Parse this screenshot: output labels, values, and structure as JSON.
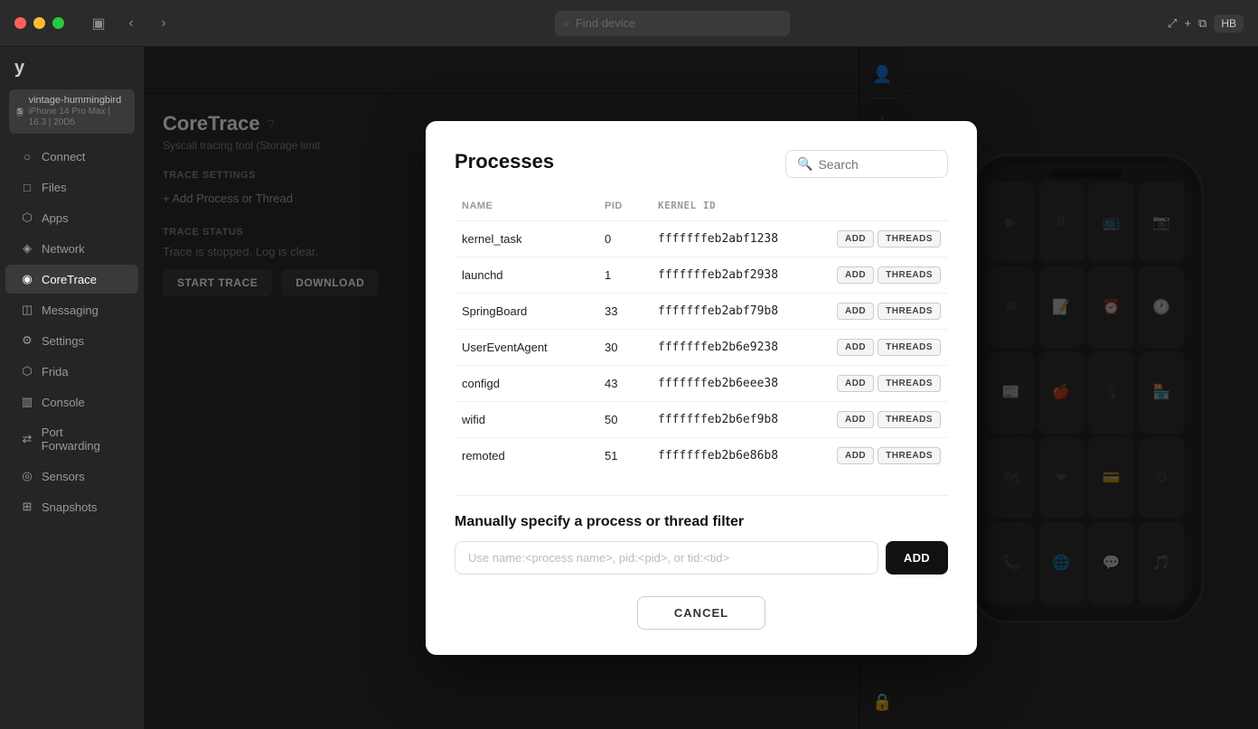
{
  "titleBar": {
    "findDevice": "Find device",
    "userBadge": "HB"
  },
  "sidebar": {
    "logo": "y",
    "device": {
      "name": "vintage-hummingbird",
      "details": "iPhone 14 Pro Max | 16.3 | 20D5"
    },
    "items": [
      {
        "id": "connect",
        "label": "Connect",
        "icon": "○"
      },
      {
        "id": "files",
        "label": "Files",
        "icon": "□"
      },
      {
        "id": "apps",
        "label": "Apps",
        "icon": "⬡"
      },
      {
        "id": "network",
        "label": "Network",
        "icon": "◈"
      },
      {
        "id": "coretrace",
        "label": "CoreTrace",
        "icon": "◉",
        "active": true
      },
      {
        "id": "messaging",
        "label": "Messaging",
        "icon": "◫"
      },
      {
        "id": "settings",
        "label": "Settings",
        "icon": "⚙"
      },
      {
        "id": "frida",
        "label": "Frida",
        "icon": "⬡"
      },
      {
        "id": "console",
        "label": "Console",
        "icon": "▥"
      },
      {
        "id": "portforwarding",
        "label": "Port Forwarding",
        "icon": "⇄"
      },
      {
        "id": "sensors",
        "label": "Sensors",
        "icon": "◎"
      },
      {
        "id": "snapshots",
        "label": "Snapshots",
        "icon": "⊞"
      }
    ]
  },
  "toolbar": {
    "buttons": [
      "⤢",
      "⊘",
      "⏸",
      "↺",
      "🗑"
    ],
    "powerLabel": "⏻"
  },
  "coreTrace": {
    "title": "CoreTrace",
    "subtitle": "Syscall tracing tool (Storage limit",
    "traceSectionLabel": "TRACE SETTINGS",
    "addProcessLabel": "+ Add Process or Thread",
    "statusSectionLabel": "TRACE STATUS",
    "statusText": "Trace is stopped. Log is clear.",
    "startBtnLabel": "START TRACE",
    "downloadBtnLabel": "DOWNLOAD"
  },
  "modal": {
    "title": "Processes",
    "search": {
      "placeholder": "Search"
    },
    "tableHeaders": {
      "name": "NAME",
      "pid": "PID",
      "kernelId": "KERNEL ID"
    },
    "processes": [
      {
        "name": "kernel_task",
        "pid": "0",
        "kernelId": "fffffffeb2abf1238"
      },
      {
        "name": "launchd",
        "pid": "1",
        "kernelId": "fffffffeb2abf2938"
      },
      {
        "name": "SpringBoard",
        "pid": "33",
        "kernelId": "fffffffeb2abf79b8"
      },
      {
        "name": "UserEventAgent",
        "pid": "30",
        "kernelId": "fffffffeb2b6e9238"
      },
      {
        "name": "configd",
        "pid": "43",
        "kernelId": "fffffffeb2b6eee38"
      },
      {
        "name": "wifid",
        "pid": "50",
        "kernelId": "fffffffeb2b6ef9b8"
      },
      {
        "name": "remoted",
        "pid": "51",
        "kernelId": "fffffffeb2b6e86b8"
      }
    ],
    "addBtnLabel": "ADD",
    "threadsBtnLabel": "THREADS",
    "manualSection": {
      "title": "Manually specify a process or thread filter",
      "inputPlaceholder": "Use name:<process name>, pid:<pid>, or tid:<tid>",
      "addBtnLabel": "ADD"
    },
    "cancelLabel": "CANCEL"
  }
}
